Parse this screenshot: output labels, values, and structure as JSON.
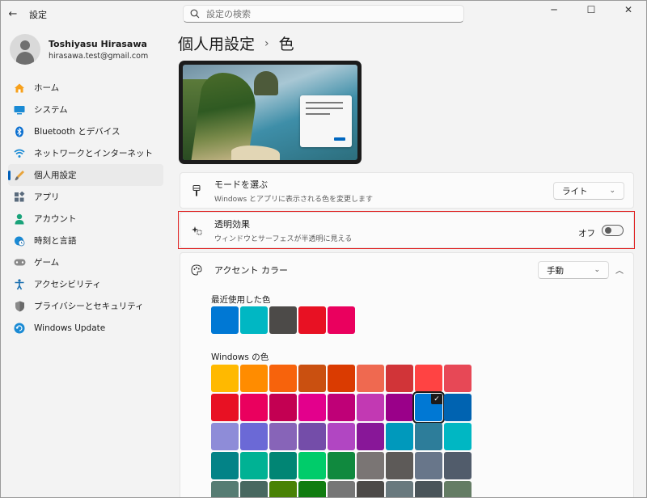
{
  "app": {
    "title": "設定"
  },
  "search": {
    "placeholder": "設定の検索"
  },
  "caption": {
    "minimize": "─",
    "maximize": "☐",
    "close": "✕"
  },
  "profile": {
    "name": "Toshiyasu Hirasawa",
    "email": "hirasawa.test@gmail.com"
  },
  "sidebar": {
    "items": [
      {
        "label": "ホーム",
        "icon": "home-icon"
      },
      {
        "label": "システム",
        "icon": "system-icon"
      },
      {
        "label": "Bluetooth とデバイス",
        "icon": "bluetooth-icon"
      },
      {
        "label": "ネットワークとインターネット",
        "icon": "wifi-icon"
      },
      {
        "label": "個人用設定",
        "icon": "brush-icon",
        "active": true
      },
      {
        "label": "アプリ",
        "icon": "apps-icon"
      },
      {
        "label": "アカウント",
        "icon": "account-icon"
      },
      {
        "label": "時刻と言語",
        "icon": "globe-clock-icon"
      },
      {
        "label": "ゲーム",
        "icon": "gamepad-icon"
      },
      {
        "label": "アクセシビリティ",
        "icon": "accessibility-icon"
      },
      {
        "label": "プライバシーとセキュリティ",
        "icon": "shield-icon"
      },
      {
        "label": "Windows Update",
        "icon": "update-icon"
      }
    ]
  },
  "breadcrumb": {
    "parent": "個人用設定",
    "separator": "›",
    "current": "色"
  },
  "mode": {
    "title": "モードを選ぶ",
    "subtitle": "Windows とアプリに表示される色を変更します",
    "value": "ライト"
  },
  "transparency": {
    "title": "透明効果",
    "subtitle": "ウィンドウとサーフェスが半透明に見える",
    "state_label": "オフ",
    "enabled": false
  },
  "accent": {
    "title": "アクセント カラー",
    "value": "手動"
  },
  "recent": {
    "label": "最近使用した色",
    "colors": [
      "#0078d4",
      "#00b7c3",
      "#4c4a48",
      "#e81123",
      "#ea005e"
    ]
  },
  "windows_colors": {
    "label": "Windows の色",
    "selected_index": 16,
    "colors": [
      "#ffb900",
      "#ff8c00",
      "#f7630c",
      "#ca5010",
      "#da3b01",
      "#ef6950",
      "#d13438",
      "#ff4343",
      "#e74856",
      "#e81123",
      "#ea005e",
      "#c30052",
      "#e3008c",
      "#bf0077",
      "#c239b3",
      "#9a0089",
      "#0078d4",
      "#0063b1",
      "#8e8cd8",
      "#6b69d6",
      "#8764b8",
      "#744da9",
      "#b146c2",
      "#881798",
      "#0099bc",
      "#2d7d9a",
      "#00b7c3",
      "#038387",
      "#00b294",
      "#018574",
      "#00cc6a",
      "#10893e",
      "#7a7574",
      "#5d5a58",
      "#68768a",
      "#515c6b",
      "#567c73",
      "#486860",
      "#498205",
      "#107c10",
      "#767676",
      "#4c4a48",
      "#69797e",
      "#4a5459",
      "#647c64"
    ]
  }
}
